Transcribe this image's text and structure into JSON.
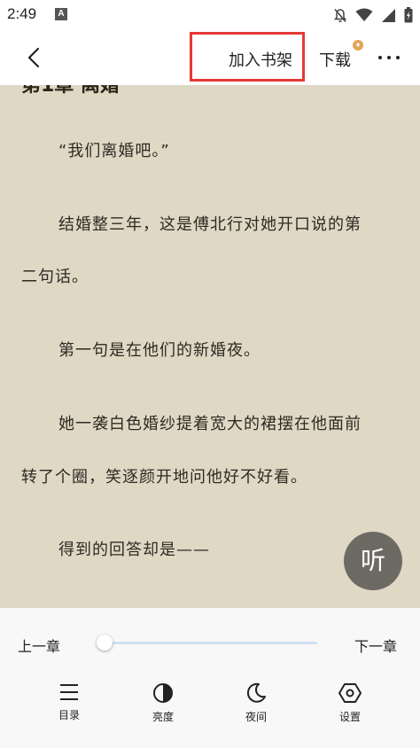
{
  "status_bar": {
    "time": "2:49",
    "app_icon_letter": "A",
    "icons": [
      "notifications-off-icon",
      "wifi-icon",
      "signal-icon",
      "battery-charging-icon"
    ]
  },
  "header": {
    "back_icon": "chevron-left-icon",
    "add_to_shelf_label": "加入书架",
    "download_label": "下载",
    "badge_icon": "vip-diamond-icon",
    "more_icon": "more-horizontal-icon",
    "highlight_color": "#e53935"
  },
  "content": {
    "chapter_title": "第1章 离婚",
    "paragraphs": [
      "“我们离婚吧。”",
      "结婚整三年，这是傅北行对她开口说的第",
      "二句话。",
      "第一句是在他们的新婚夜。",
      "她一袭白色婚纱提着宽大的裙摆在他面前",
      "转了个圈，笑逐颜开地问他好不好看。",
      "得到的回答却是——"
    ],
    "background_color": "#ded8c5"
  },
  "listen_button": {
    "label": "听"
  },
  "bottom_panel": {
    "prev_chapter_label": "上一章",
    "next_chapter_label": "下一章",
    "progress": 0.0,
    "tools": [
      {
        "icon": "menu-list-icon",
        "label": "目录"
      },
      {
        "icon": "brightness-icon",
        "label": "亮度"
      },
      {
        "icon": "moon-icon",
        "label": "夜间"
      },
      {
        "icon": "settings-hexagon-icon",
        "label": "设置"
      }
    ]
  }
}
